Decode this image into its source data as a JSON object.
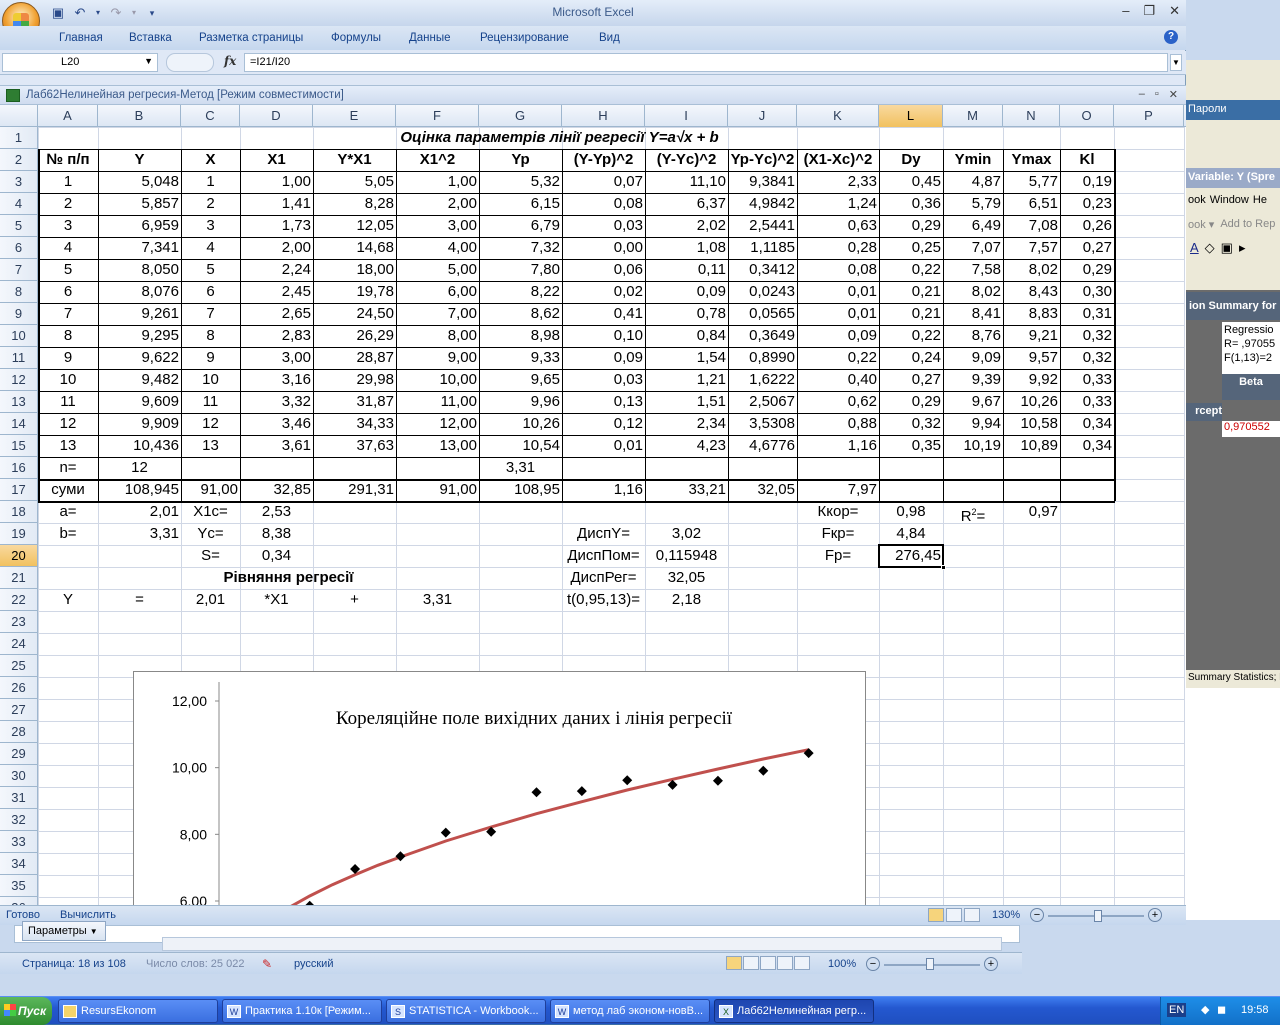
{
  "app": {
    "title": "Microsoft Excel"
  },
  "ribbon": {
    "tabs": [
      "Главная",
      "Вставка",
      "Разметка страницы",
      "Формулы",
      "Данные",
      "Рецензирование",
      "Вид"
    ]
  },
  "formula_bar": {
    "name_box": "L20",
    "fx": "fx",
    "formula": "=I21/I20"
  },
  "document": {
    "title": "Лаб62Нелинейная регресия-Метод  [Режим совместимости]"
  },
  "columns": [
    "A",
    "B",
    "C",
    "D",
    "E",
    "F",
    "G",
    "H",
    "I",
    "J",
    "K",
    "L",
    "M",
    "N",
    "O",
    "P"
  ],
  "selected_cell": {
    "column": "L",
    "row": "20"
  },
  "title_row": "Оцінка параметрів    лінії регресії     Y=a√x  + b",
  "header": [
    "№ п/п",
    "Y",
    "X",
    "X1",
    "Y*X1",
    "X1^2",
    "Yp",
    "(Y-Yp)^2",
    "(Y-Yc)^2",
    "Yp-Yc)^2",
    "(X1-Xc)^2",
    "Dy",
    "Ymin",
    "Ymax",
    "Kl"
  ],
  "data_rows": [
    [
      "1",
      "5,048",
      "1",
      "1,00",
      "5,05",
      "1,00",
      "5,32",
      "0,07",
      "11,10",
      "9,3841",
      "2,33",
      "0,45",
      "4,87",
      "5,77",
      "0,19"
    ],
    [
      "2",
      "5,857",
      "2",
      "1,41",
      "8,28",
      "2,00",
      "6,15",
      "0,08",
      "6,37",
      "4,9842",
      "1,24",
      "0,36",
      "5,79",
      "6,51",
      "0,23"
    ],
    [
      "3",
      "6,959",
      "3",
      "1,73",
      "12,05",
      "3,00",
      "6,79",
      "0,03",
      "2,02",
      "2,5441",
      "0,63",
      "0,29",
      "6,49",
      "7,08",
      "0,26"
    ],
    [
      "4",
      "7,341",
      "4",
      "2,00",
      "14,68",
      "4,00",
      "7,32",
      "0,00",
      "1,08",
      "1,1185",
      "0,28",
      "0,25",
      "7,07",
      "7,57",
      "0,27"
    ],
    [
      "5",
      "8,050",
      "5",
      "2,24",
      "18,00",
      "5,00",
      "7,80",
      "0,06",
      "0,11",
      "0,3412",
      "0,08",
      "0,22",
      "7,58",
      "8,02",
      "0,29"
    ],
    [
      "6",
      "8,076",
      "6",
      "2,45",
      "19,78",
      "6,00",
      "8,22",
      "0,02",
      "0,09",
      "0,0243",
      "0,01",
      "0,21",
      "8,02",
      "8,43",
      "0,30"
    ],
    [
      "7",
      "9,261",
      "7",
      "2,65",
      "24,50",
      "7,00",
      "8,62",
      "0,41",
      "0,78",
      "0,0565",
      "0,01",
      "0,21",
      "8,41",
      "8,83",
      "0,31"
    ],
    [
      "8",
      "9,295",
      "8",
      "2,83",
      "26,29",
      "8,00",
      "8,98",
      "0,10",
      "0,84",
      "0,3649",
      "0,09",
      "0,22",
      "8,76",
      "9,21",
      "0,32"
    ],
    [
      "9",
      "9,622",
      "9",
      "3,00",
      "28,87",
      "9,00",
      "9,33",
      "0,09",
      "1,54",
      "0,8990",
      "0,22",
      "0,24",
      "9,09",
      "9,57",
      "0,32"
    ],
    [
      "10",
      "9,482",
      "10",
      "3,16",
      "29,98",
      "10,00",
      "9,65",
      "0,03",
      "1,21",
      "1,6222",
      "0,40",
      "0,27",
      "9,39",
      "9,92",
      "0,33"
    ],
    [
      "11",
      "9,609",
      "11",
      "3,32",
      "31,87",
      "11,00",
      "9,96",
      "0,13",
      "1,51",
      "2,5067",
      "0,62",
      "0,29",
      "9,67",
      "10,26",
      "0,33"
    ],
    [
      "12",
      "9,909",
      "12",
      "3,46",
      "34,33",
      "12,00",
      "10,26",
      "0,12",
      "2,34",
      "3,5308",
      "0,88",
      "0,32",
      "9,94",
      "10,58",
      "0,34"
    ],
    [
      "13",
      "10,436",
      "13",
      "3,61",
      "37,63",
      "13,00",
      "10,54",
      "0,01",
      "4,23",
      "4,6776",
      "1,16",
      "0,35",
      "10,19",
      "10,89",
      "0,34"
    ]
  ],
  "row16": {
    "label": "n=",
    "n": "12",
    "g": "3,31"
  },
  "row17": [
    "суми",
    "108,945",
    "91,00",
    "32,85",
    "291,31",
    "91,00",
    "108,95",
    "1,16",
    "33,21",
    "32,05",
    "7,97"
  ],
  "params": {
    "a_label": "a=",
    "a": "2,01",
    "x1c_label": "X1c=",
    "x1c": "2,53",
    "kkor_label": "Ккор=",
    "kkor": "0,98",
    "r2_label": "R",
    "r2_sup": "2",
    "r2_eq": "=",
    "r2": "0,97",
    "b_label": "b=",
    "b": "3,31",
    "yc_label": "Yc=",
    "yc": "8,38",
    "dispy_label": "ДиспY=",
    "dispy": "3,02",
    "fkr_label": "Fкр=",
    "fkr": "4,84",
    "s_label": "S=",
    "s": "0,34",
    "disppom_label": "ДиспПом=",
    "disppom": "0,115948",
    "fp_label": "Fp=",
    "fp": "276,45",
    "eq_title": "Рівняння регресії",
    "dispreg_label": "ДиспРег=",
    "dispreg": "32,05",
    "eq_y": "Y",
    "eq_eq": "=",
    "eq_a": "2,01",
    "eq_x1": "*X1",
    "eq_plus": "+",
    "eq_b": "3,31",
    "t_label": "t(0,95,13)=",
    "t": "2,18"
  },
  "chart_data": {
    "type": "scatter",
    "title": "Кореляційне поле вихідних даних і лінія регресії",
    "ytick_labels": [
      "12,00",
      "10,00",
      "8,00",
      "6,00"
    ],
    "yticks": [
      12,
      10,
      8,
      6
    ],
    "ylim": [
      6,
      12
    ],
    "xlim": [
      0,
      14
    ],
    "x": [
      1,
      2,
      3,
      4,
      5,
      6,
      7,
      8,
      9,
      10,
      11,
      12,
      13
    ],
    "y": [
      5.048,
      5.857,
      6.959,
      7.341,
      8.05,
      8.076,
      9.261,
      9.295,
      9.622,
      9.482,
      9.609,
      9.909,
      10.436
    ],
    "fit_x": [
      1,
      1.5,
      2,
      2.5,
      3,
      3.5,
      4,
      5,
      6,
      7,
      8,
      9,
      10,
      11,
      12,
      13
    ],
    "fit_y": [
      5.32,
      5.77,
      6.15,
      6.49,
      6.79,
      7.07,
      7.32,
      7.8,
      8.22,
      8.62,
      8.98,
      9.33,
      9.65,
      9.96,
      10.26,
      10.54
    ],
    "marker_color": "#000000",
    "line_color": "#c0504d"
  },
  "status": {
    "ready": "Готово",
    "calc": "Вычислить",
    "zoom": "130%"
  },
  "statistica_panel": {
    "title_partial": "Variable: Y (Spre",
    "menu": [
      "ook",
      "Window",
      "He"
    ],
    "menu2": [
      "ook ▾",
      "Add to Rep"
    ],
    "header": "ion Summary for",
    "regressio": "Regressio",
    "r": "R= ,97055",
    "f": "F(1,13)=2",
    "beta": "Beta",
    "intercept": "rcept",
    "value": "0,970552",
    "summary_stats": "Summary Statistics; D",
    "paroli": "Пароли"
  },
  "word": {
    "params_button": "Параметры",
    "page": "Страница: 18 из 108",
    "words": "Число слов: 25 022",
    "lang": "русский",
    "zoom": "100%"
  },
  "taskbar": {
    "start": "Пуск",
    "items": [
      "ResursEkonom",
      "Практика 1.10к [Режим...",
      "STATISTICA - Workbook...",
      "метод лаб эконом-новВ...",
      "Лаб62Нелинейная регр..."
    ],
    "lang": "EN",
    "time": "19:58"
  }
}
